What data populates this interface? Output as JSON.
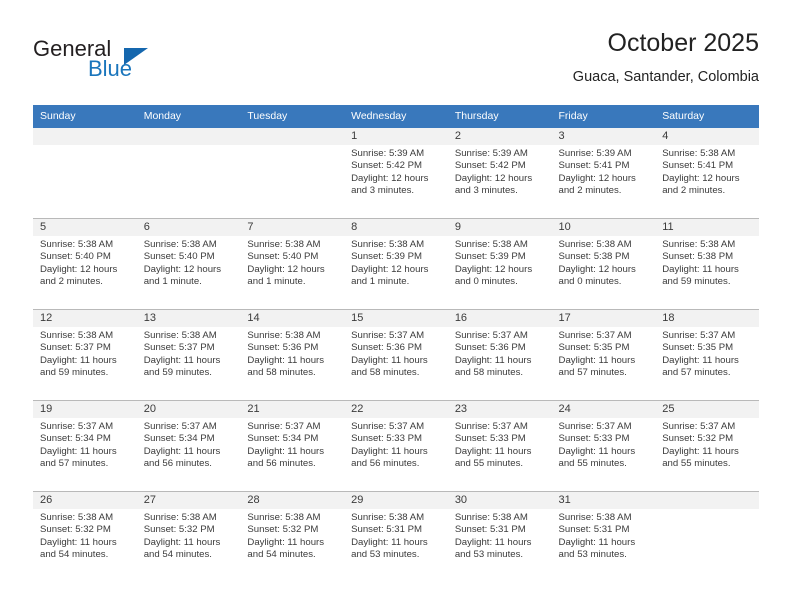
{
  "brand": {
    "word_one": "General",
    "word_two": "Blue",
    "triangle_icon": "triangle-icon",
    "accent_color": "#1a75bc"
  },
  "header": {
    "title": "October 2025",
    "location": "Guaca, Santander, Colombia"
  },
  "calendar": {
    "header_bg": "#3978bc",
    "daynum_bg": "#f2f2f2",
    "weekday_headers": [
      "Sunday",
      "Monday",
      "Tuesday",
      "Wednesday",
      "Thursday",
      "Friday",
      "Saturday"
    ],
    "weeks": [
      [
        {
          "day": "",
          "empty": true,
          "sunrise": "",
          "sunset": "",
          "daylight_line1": "",
          "daylight_line2": ""
        },
        {
          "day": "",
          "empty": true,
          "sunrise": "",
          "sunset": "",
          "daylight_line1": "",
          "daylight_line2": ""
        },
        {
          "day": "",
          "empty": true,
          "sunrise": "",
          "sunset": "",
          "daylight_line1": "",
          "daylight_line2": ""
        },
        {
          "day": "1",
          "empty": false,
          "sunrise": "Sunrise: 5:39 AM",
          "sunset": "Sunset: 5:42 PM",
          "daylight_line1": "Daylight: 12 hours",
          "daylight_line2": "and 3 minutes."
        },
        {
          "day": "2",
          "empty": false,
          "sunrise": "Sunrise: 5:39 AM",
          "sunset": "Sunset: 5:42 PM",
          "daylight_line1": "Daylight: 12 hours",
          "daylight_line2": "and 3 minutes."
        },
        {
          "day": "3",
          "empty": false,
          "sunrise": "Sunrise: 5:39 AM",
          "sunset": "Sunset: 5:41 PM",
          "daylight_line1": "Daylight: 12 hours",
          "daylight_line2": "and 2 minutes."
        },
        {
          "day": "4",
          "empty": false,
          "sunrise": "Sunrise: 5:38 AM",
          "sunset": "Sunset: 5:41 PM",
          "daylight_line1": "Daylight: 12 hours",
          "daylight_line2": "and 2 minutes."
        }
      ],
      [
        {
          "day": "5",
          "empty": false,
          "sunrise": "Sunrise: 5:38 AM",
          "sunset": "Sunset: 5:40 PM",
          "daylight_line1": "Daylight: 12 hours",
          "daylight_line2": "and 2 minutes."
        },
        {
          "day": "6",
          "empty": false,
          "sunrise": "Sunrise: 5:38 AM",
          "sunset": "Sunset: 5:40 PM",
          "daylight_line1": "Daylight: 12 hours",
          "daylight_line2": "and 1 minute."
        },
        {
          "day": "7",
          "empty": false,
          "sunrise": "Sunrise: 5:38 AM",
          "sunset": "Sunset: 5:40 PM",
          "daylight_line1": "Daylight: 12 hours",
          "daylight_line2": "and 1 minute."
        },
        {
          "day": "8",
          "empty": false,
          "sunrise": "Sunrise: 5:38 AM",
          "sunset": "Sunset: 5:39 PM",
          "daylight_line1": "Daylight: 12 hours",
          "daylight_line2": "and 1 minute."
        },
        {
          "day": "9",
          "empty": false,
          "sunrise": "Sunrise: 5:38 AM",
          "sunset": "Sunset: 5:39 PM",
          "daylight_line1": "Daylight: 12 hours",
          "daylight_line2": "and 0 minutes."
        },
        {
          "day": "10",
          "empty": false,
          "sunrise": "Sunrise: 5:38 AM",
          "sunset": "Sunset: 5:38 PM",
          "daylight_line1": "Daylight: 12 hours",
          "daylight_line2": "and 0 minutes."
        },
        {
          "day": "11",
          "empty": false,
          "sunrise": "Sunrise: 5:38 AM",
          "sunset": "Sunset: 5:38 PM",
          "daylight_line1": "Daylight: 11 hours",
          "daylight_line2": "and 59 minutes."
        }
      ],
      [
        {
          "day": "12",
          "empty": false,
          "sunrise": "Sunrise: 5:38 AM",
          "sunset": "Sunset: 5:37 PM",
          "daylight_line1": "Daylight: 11 hours",
          "daylight_line2": "and 59 minutes."
        },
        {
          "day": "13",
          "empty": false,
          "sunrise": "Sunrise: 5:38 AM",
          "sunset": "Sunset: 5:37 PM",
          "daylight_line1": "Daylight: 11 hours",
          "daylight_line2": "and 59 minutes."
        },
        {
          "day": "14",
          "empty": false,
          "sunrise": "Sunrise: 5:38 AM",
          "sunset": "Sunset: 5:36 PM",
          "daylight_line1": "Daylight: 11 hours",
          "daylight_line2": "and 58 minutes."
        },
        {
          "day": "15",
          "empty": false,
          "sunrise": "Sunrise: 5:37 AM",
          "sunset": "Sunset: 5:36 PM",
          "daylight_line1": "Daylight: 11 hours",
          "daylight_line2": "and 58 minutes."
        },
        {
          "day": "16",
          "empty": false,
          "sunrise": "Sunrise: 5:37 AM",
          "sunset": "Sunset: 5:36 PM",
          "daylight_line1": "Daylight: 11 hours",
          "daylight_line2": "and 58 minutes."
        },
        {
          "day": "17",
          "empty": false,
          "sunrise": "Sunrise: 5:37 AM",
          "sunset": "Sunset: 5:35 PM",
          "daylight_line1": "Daylight: 11 hours",
          "daylight_line2": "and 57 minutes."
        },
        {
          "day": "18",
          "empty": false,
          "sunrise": "Sunrise: 5:37 AM",
          "sunset": "Sunset: 5:35 PM",
          "daylight_line1": "Daylight: 11 hours",
          "daylight_line2": "and 57 minutes."
        }
      ],
      [
        {
          "day": "19",
          "empty": false,
          "sunrise": "Sunrise: 5:37 AM",
          "sunset": "Sunset: 5:34 PM",
          "daylight_line1": "Daylight: 11 hours",
          "daylight_line2": "and 57 minutes."
        },
        {
          "day": "20",
          "empty": false,
          "sunrise": "Sunrise: 5:37 AM",
          "sunset": "Sunset: 5:34 PM",
          "daylight_line1": "Daylight: 11 hours",
          "daylight_line2": "and 56 minutes."
        },
        {
          "day": "21",
          "empty": false,
          "sunrise": "Sunrise: 5:37 AM",
          "sunset": "Sunset: 5:34 PM",
          "daylight_line1": "Daylight: 11 hours",
          "daylight_line2": "and 56 minutes."
        },
        {
          "day": "22",
          "empty": false,
          "sunrise": "Sunrise: 5:37 AM",
          "sunset": "Sunset: 5:33 PM",
          "daylight_line1": "Daylight: 11 hours",
          "daylight_line2": "and 56 minutes."
        },
        {
          "day": "23",
          "empty": false,
          "sunrise": "Sunrise: 5:37 AM",
          "sunset": "Sunset: 5:33 PM",
          "daylight_line1": "Daylight: 11 hours",
          "daylight_line2": "and 55 minutes."
        },
        {
          "day": "24",
          "empty": false,
          "sunrise": "Sunrise: 5:37 AM",
          "sunset": "Sunset: 5:33 PM",
          "daylight_line1": "Daylight: 11 hours",
          "daylight_line2": "and 55 minutes."
        },
        {
          "day": "25",
          "empty": false,
          "sunrise": "Sunrise: 5:37 AM",
          "sunset": "Sunset: 5:32 PM",
          "daylight_line1": "Daylight: 11 hours",
          "daylight_line2": "and 55 minutes."
        }
      ],
      [
        {
          "day": "26",
          "empty": false,
          "sunrise": "Sunrise: 5:38 AM",
          "sunset": "Sunset: 5:32 PM",
          "daylight_line1": "Daylight: 11 hours",
          "daylight_line2": "and 54 minutes."
        },
        {
          "day": "27",
          "empty": false,
          "sunrise": "Sunrise: 5:38 AM",
          "sunset": "Sunset: 5:32 PM",
          "daylight_line1": "Daylight: 11 hours",
          "daylight_line2": "and 54 minutes."
        },
        {
          "day": "28",
          "empty": false,
          "sunrise": "Sunrise: 5:38 AM",
          "sunset": "Sunset: 5:32 PM",
          "daylight_line1": "Daylight: 11 hours",
          "daylight_line2": "and 54 minutes."
        },
        {
          "day": "29",
          "empty": false,
          "sunrise": "Sunrise: 5:38 AM",
          "sunset": "Sunset: 5:31 PM",
          "daylight_line1": "Daylight: 11 hours",
          "daylight_line2": "and 53 minutes."
        },
        {
          "day": "30",
          "empty": false,
          "sunrise": "Sunrise: 5:38 AM",
          "sunset": "Sunset: 5:31 PM",
          "daylight_line1": "Daylight: 11 hours",
          "daylight_line2": "and 53 minutes."
        },
        {
          "day": "31",
          "empty": false,
          "sunrise": "Sunrise: 5:38 AM",
          "sunset": "Sunset: 5:31 PM",
          "daylight_line1": "Daylight: 11 hours",
          "daylight_line2": "and 53 minutes."
        },
        {
          "day": "",
          "empty": true,
          "sunrise": "",
          "sunset": "",
          "daylight_line1": "",
          "daylight_line2": ""
        }
      ]
    ]
  }
}
